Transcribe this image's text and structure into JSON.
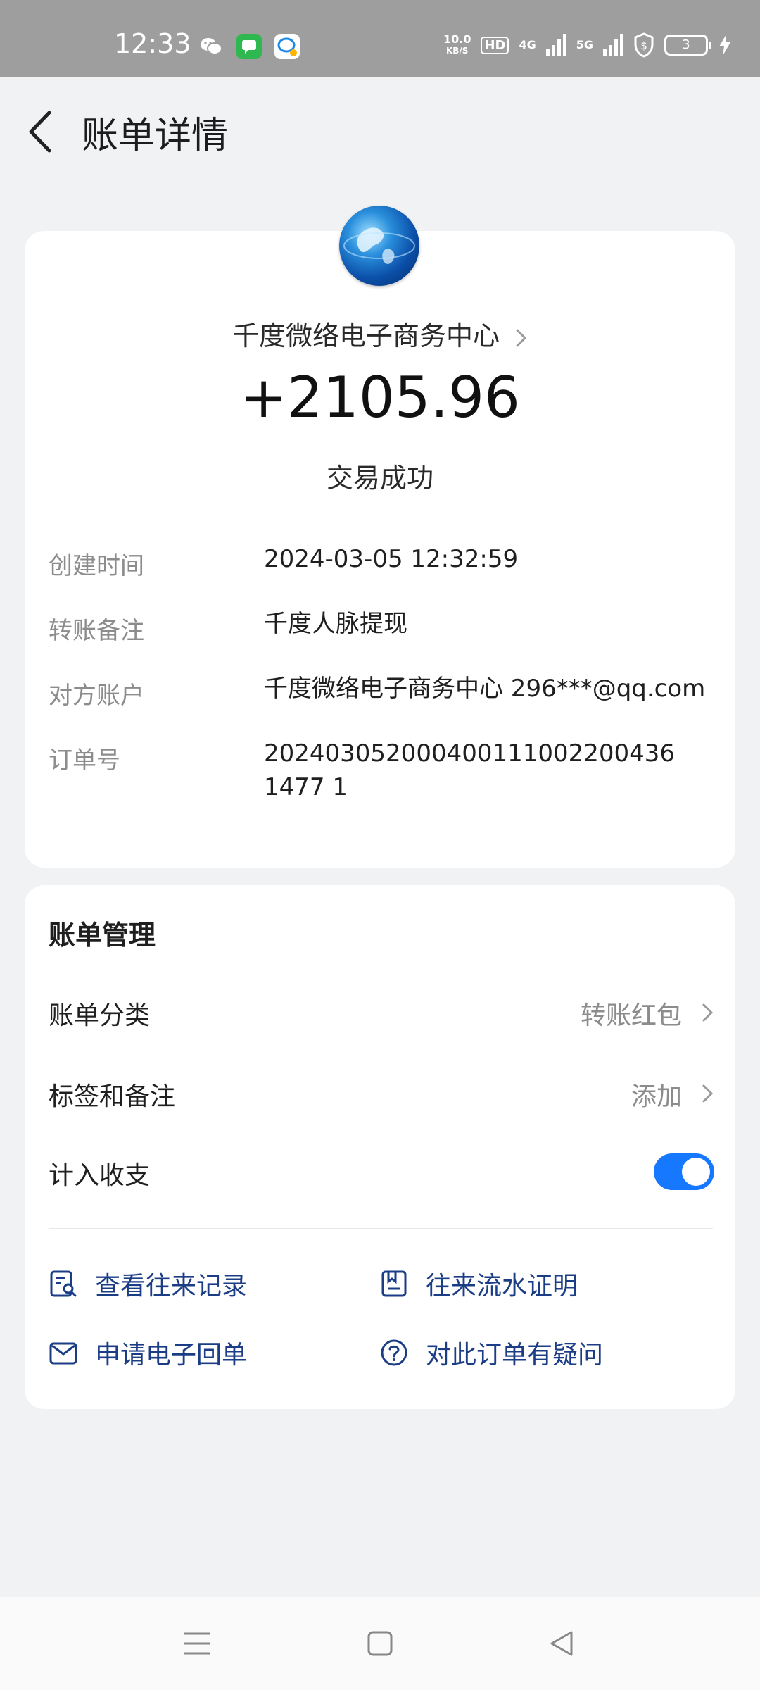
{
  "status_bar": {
    "time": "12:33",
    "speed_value": "10.0",
    "speed_unit": "KB/S",
    "hd_label": "HD",
    "net_4g": "4G",
    "net_5g": "5G",
    "battery_level": "3",
    "icons": [
      "wechat-icon",
      "messages-icon",
      "chat-app-icon",
      "signal-icon",
      "shield-dollar-icon",
      "battery-icon",
      "charging-icon"
    ]
  },
  "header": {
    "title": "账单详情"
  },
  "summary": {
    "merchant": "千度微络电子商务中心",
    "amount": "+2105.96",
    "status": "交易成功"
  },
  "details": [
    {
      "label": "创建时间",
      "value": "2024-03-05 12:32:59"
    },
    {
      "label": "转账备注",
      "value": "千度人脉提现"
    },
    {
      "label": "对方账户",
      "value": "千度微络电子商务中心 296***@qq.com"
    },
    {
      "label": "订单号",
      "value": "2024030520004001110022004361477 1"
    }
  ],
  "management": {
    "title": "账单管理",
    "category_label": "账单分类",
    "category_value": "转账红包",
    "tags_label": "标签和备注",
    "tags_value": "添加",
    "count_label": "计入收支",
    "count_enabled": true
  },
  "actions": {
    "view_records": "查看往来记录",
    "statement_proof": "往来流水证明",
    "request_receipt": "申请电子回单",
    "order_question": "对此订单有疑问"
  },
  "colors": {
    "accent": "#1677ff",
    "action_text": "#1b3d86",
    "background": "#f1f2f4",
    "status_bar": "#9e9e9e"
  }
}
